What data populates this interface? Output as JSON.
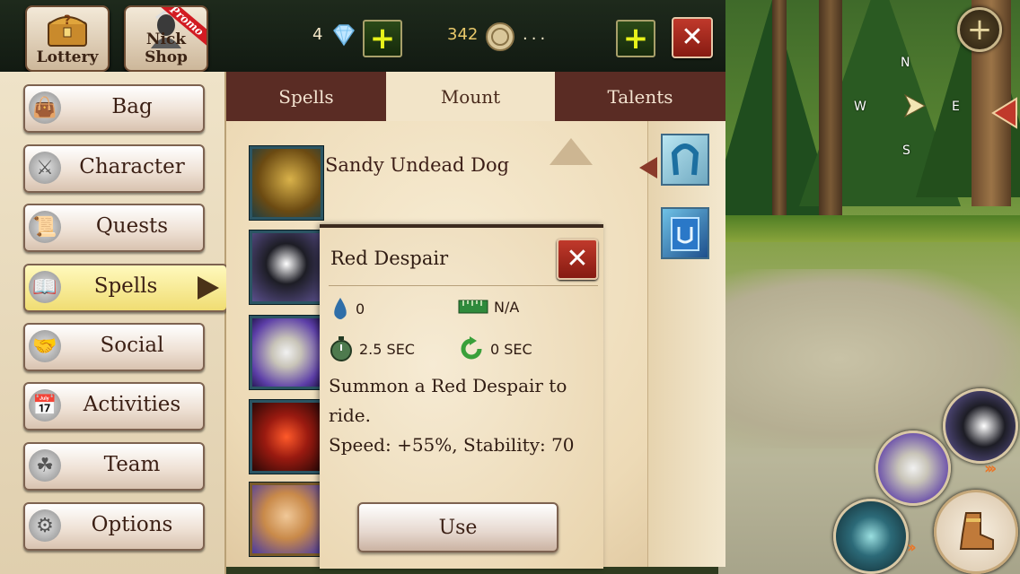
{
  "top_bar": {
    "lottery_label": "Lottery",
    "shop_label": "Nick Shop",
    "promo_label": "Promo",
    "diamonds": "4",
    "coins": "342",
    "coins_suffix": "..."
  },
  "menu": {
    "items": [
      {
        "label": "Bag",
        "icon": "bag-icon"
      },
      {
        "label": "Character",
        "icon": "character-icon"
      },
      {
        "label": "Quests",
        "icon": "quests-icon"
      },
      {
        "label": "Spells",
        "icon": "spells-icon",
        "active": true
      },
      {
        "label": "Social",
        "icon": "social-icon"
      },
      {
        "label": "Activities",
        "icon": "activities-icon"
      },
      {
        "label": "Team",
        "icon": "team-icon"
      },
      {
        "label": "Options",
        "icon": "options-icon"
      }
    ]
  },
  "tabs": [
    {
      "label": "Spells"
    },
    {
      "label": "Mount",
      "active": true
    },
    {
      "label": "Talents"
    }
  ],
  "mount_list": {
    "first_name": "Sandy Undead Dog"
  },
  "popup": {
    "title": "Red Despair",
    "mana": "0",
    "range": "N/A",
    "cast_time": "2.5 SEC",
    "cooldown": "0 SEC",
    "description_1": "Summon a Red Despair to",
    "description_2": "ride.",
    "description_3": "Speed: +55%, Stability: 70",
    "use_label": "Use"
  },
  "compass": {
    "n": "N",
    "s": "S",
    "e": "E",
    "w": "W"
  },
  "colors": {
    "tab_dark": "#5a2c24",
    "parchment": "#f2e4c8",
    "close_red": "#c0392b",
    "plus_yellow": "#e8f21a"
  }
}
